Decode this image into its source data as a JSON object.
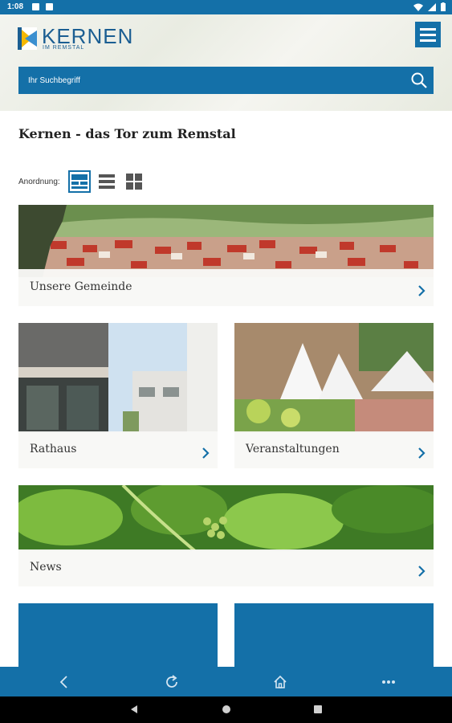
{
  "status_bar": {
    "time": "1:08"
  },
  "header": {
    "logo_title": "KERNEN",
    "logo_subtitle": "IM REMSTAL",
    "search_placeholder": "Ihr Suchbegriff"
  },
  "main": {
    "page_title": "Kernen - das Tor zum Remstal",
    "arrangement_label": "Anordnung:",
    "tiles": [
      {
        "label": "Unsere Gemeinde"
      },
      {
        "label": "Rathaus"
      },
      {
        "label": "Veranstaltungen"
      },
      {
        "label": "News"
      }
    ]
  },
  "colors": {
    "brand_blue": "#1470a8",
    "accent_yellow": "#f5b800"
  },
  "icons": [
    "menu-icon",
    "search-icon",
    "chevron-right-icon",
    "back-icon",
    "reload-icon",
    "home-icon",
    "more-icon"
  ]
}
